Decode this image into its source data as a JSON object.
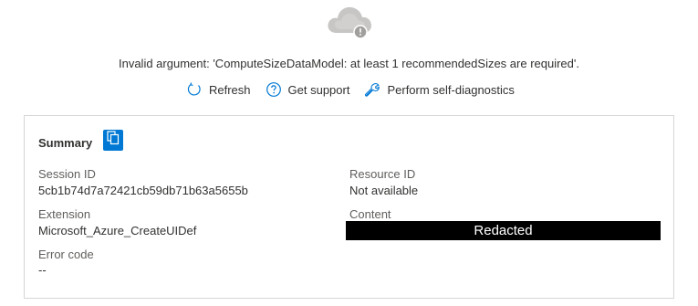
{
  "error": {
    "message": "Invalid argument: 'ComputeSizeDataModel: at least 1 recommendedSizes are required'."
  },
  "actions": {
    "refresh": "Refresh",
    "support": "Get support",
    "diagnostics": "Perform self-diagnostics"
  },
  "summary": {
    "title": "Summary",
    "session_id_label": "Session ID",
    "session_id_value": "5cb1b74d7a72421cb59db71b63a5655b",
    "resource_id_label": "Resource ID",
    "resource_id_value": "Not available",
    "extension_label": "Extension",
    "extension_value": "Microsoft_Azure_CreateUIDef",
    "content_label": "Content",
    "content_value": "Redacted",
    "error_code_label": "Error code",
    "error_code_value": "--"
  },
  "colors": {
    "accent": "#0078d4",
    "cloud": "#c8c6c4",
    "text": "#323130",
    "muted": "#605e5c",
    "border": "#d6d6d6"
  },
  "icons": {
    "cloud": "cloud-error-icon",
    "refresh": "refresh-icon",
    "support": "question-circle-icon",
    "diagnostics": "wrench-icon",
    "copy": "copy-icon"
  }
}
